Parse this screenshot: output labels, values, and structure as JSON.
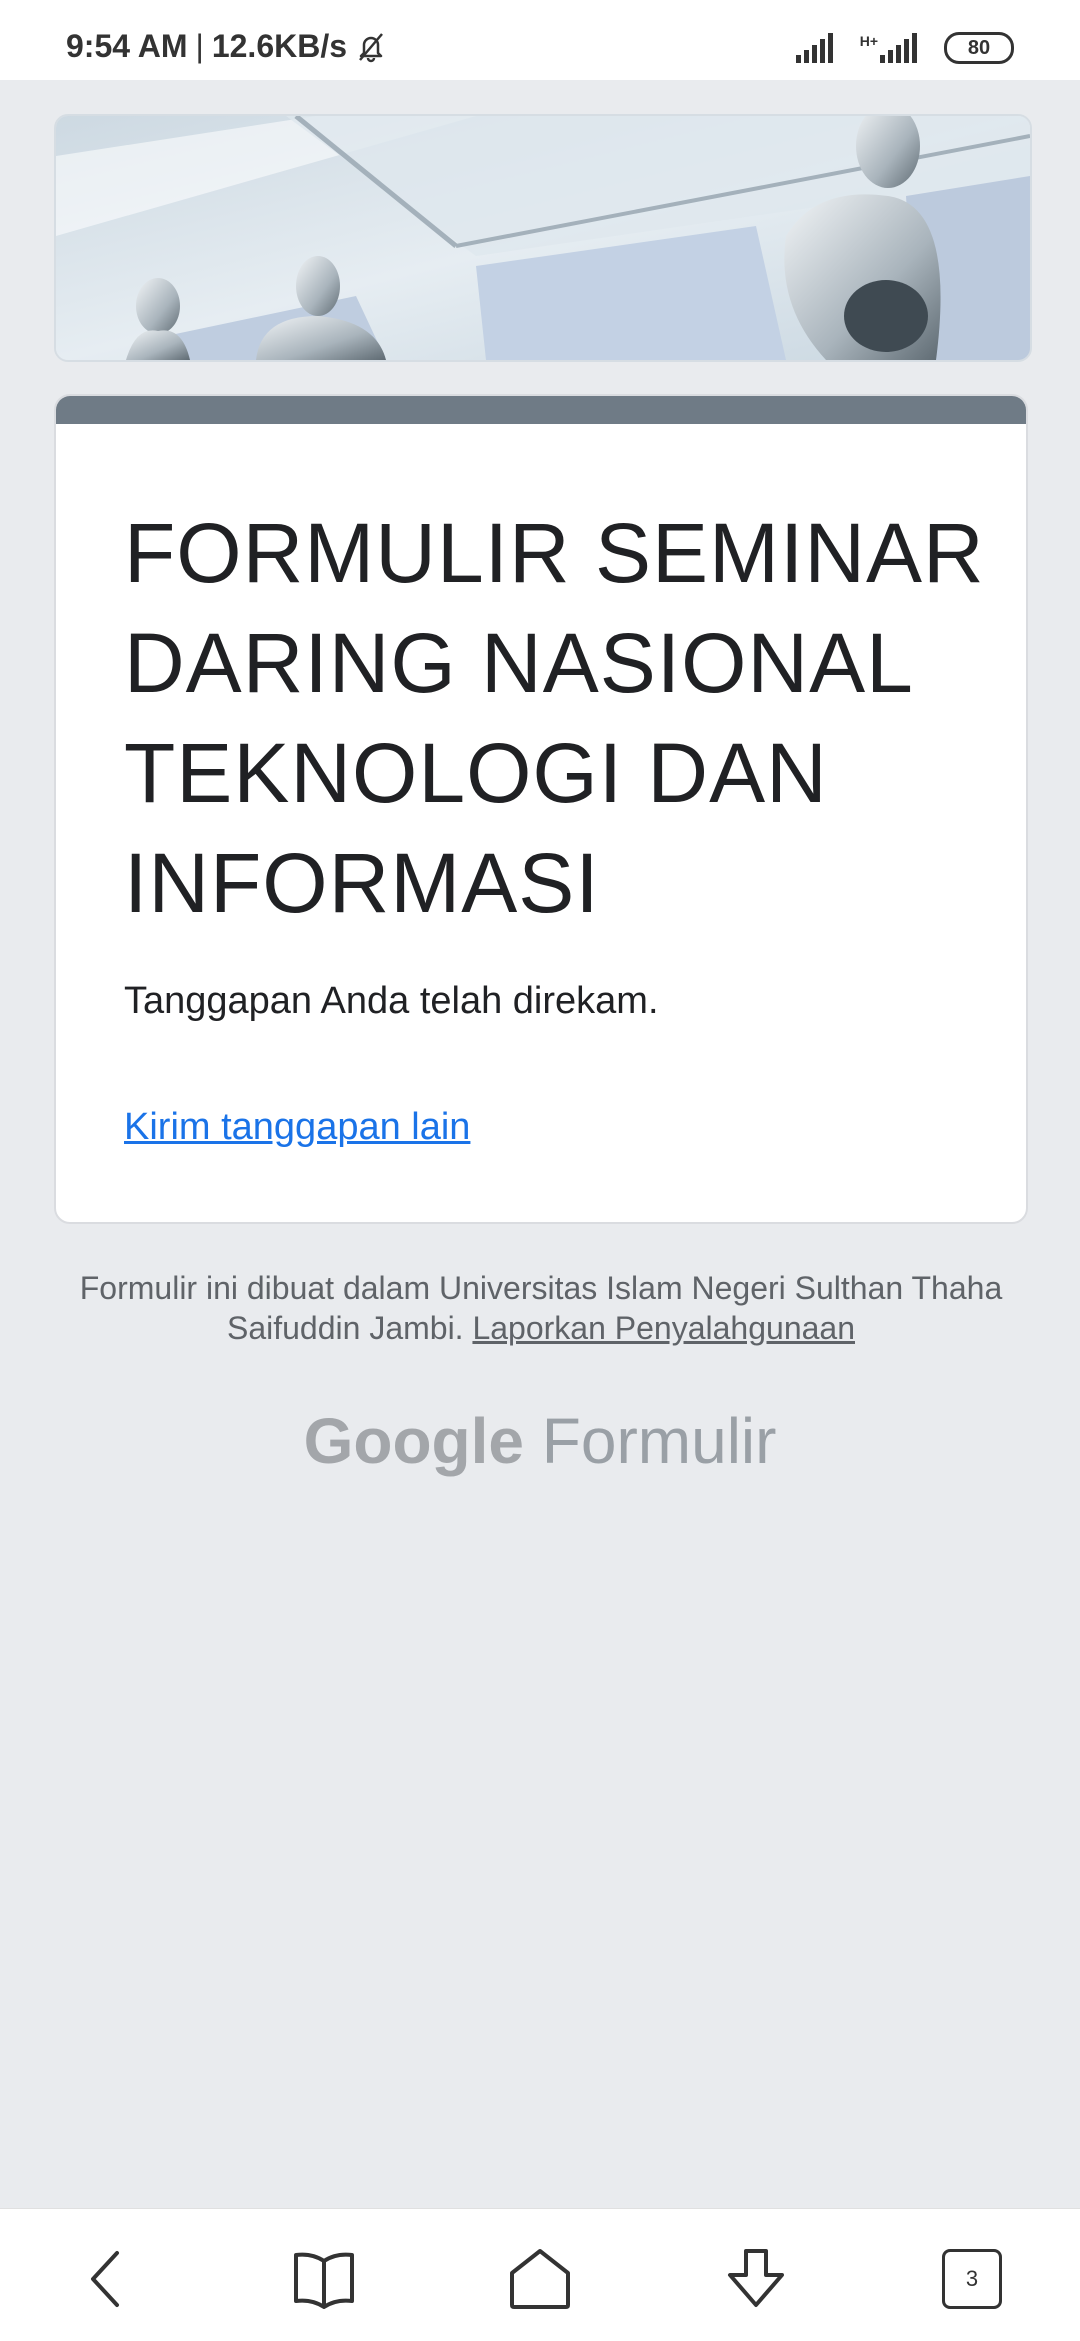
{
  "status_bar": {
    "time": "9:54 AM",
    "separator": "|",
    "speed": "12.6KB/s",
    "network_type": "H+",
    "battery": "80"
  },
  "form": {
    "title": "FORMULIR SEMINAR DARING NASIONAL TEKNOLOGI DAN INFORMASI",
    "confirmation": "Tanggapan Anda telah direkam.",
    "another_response_link": "Kirim tanggapan lain",
    "accent_color": "#6f7b86"
  },
  "footer": {
    "created_text": "Formulir ini dibuat dalam Universitas Islam Negeri Sulthan Thaha Saifuddin Jambi.",
    "report_link": "Laporkan Penyalahgunaan",
    "brand_google": "Google",
    "brand_product": "Formulir"
  },
  "nav": {
    "tabs_count": "3",
    "icons": [
      "back-icon",
      "bookmarks-icon",
      "home-icon",
      "download-icon",
      "tabs-icon"
    ]
  },
  "colors": {
    "link": "#1a73e8",
    "background": "#e9ebee"
  }
}
